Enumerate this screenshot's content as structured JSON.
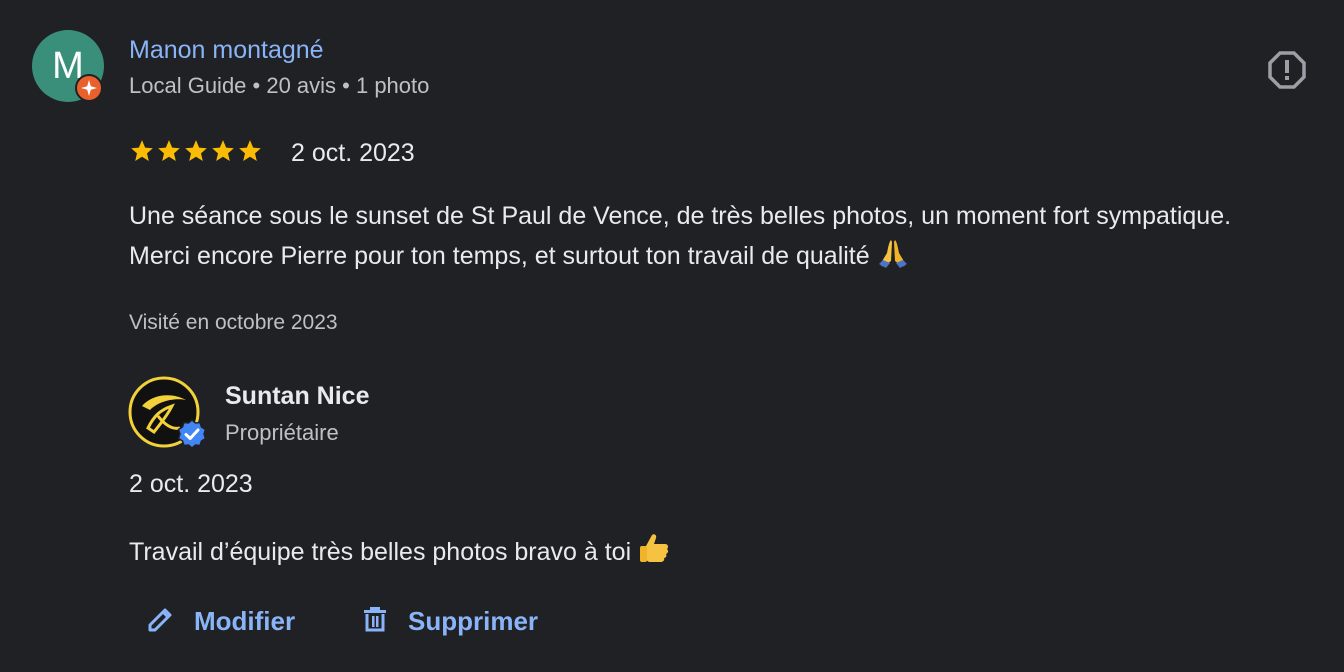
{
  "reviewer": {
    "initial": "M",
    "name": "Manon montagné",
    "meta": "Local Guide • 20 avis • 1 photo"
  },
  "review": {
    "rating": 5,
    "date": "2 oct. 2023",
    "text": "Une séance sous le sunset de St Paul de Vence, de très belles photos, un moment fort sympatique. Merci encore Pierre pour ton temps, et surtout ton travail de qualité",
    "visit": "Visité en octobre 2023"
  },
  "owner_reply": {
    "name": "Suntan Nice",
    "role": "Propriétaire",
    "date": "2 oct. 2023",
    "text": "Travail d’équipe très belles photos bravo à toi"
  },
  "actions": {
    "edit_label": "Modifier",
    "delete_label": "Supprimer"
  },
  "icons": {
    "report": "report-flag-icon",
    "local_guide": "local-guide-badge-icon",
    "verified": "verified-check-icon",
    "edit": "pencil-icon",
    "delete": "trash-icon"
  },
  "colors": {
    "background": "#202124",
    "link": "#8ab4f8",
    "star": "#fbbc04",
    "avatar": "#3a8f7a",
    "guide_badge": "#e8612c",
    "verified": "#4285f4"
  }
}
